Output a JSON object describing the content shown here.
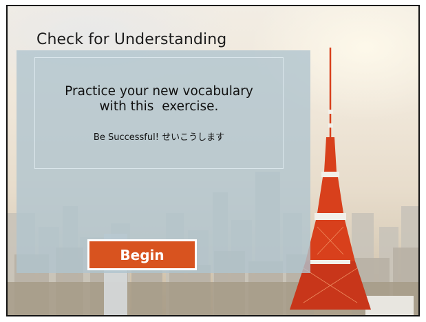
{
  "slide": {
    "title": "Check for Understanding",
    "prompt_line1": "Practice your new vocabulary",
    "prompt_line2": "with this  exercise.",
    "subtitle": "Be Successful! せいこうします",
    "begin_label": "Begin"
  },
  "colors": {
    "panel": "#b0c4ce",
    "button": "#d8531f",
    "tower_red": "#d8401c",
    "tower_white": "#f2f0ea"
  },
  "background": {
    "image": "Tokyo skyline with Tokyo Tower",
    "icons": [
      "tokyo-tower"
    ]
  }
}
